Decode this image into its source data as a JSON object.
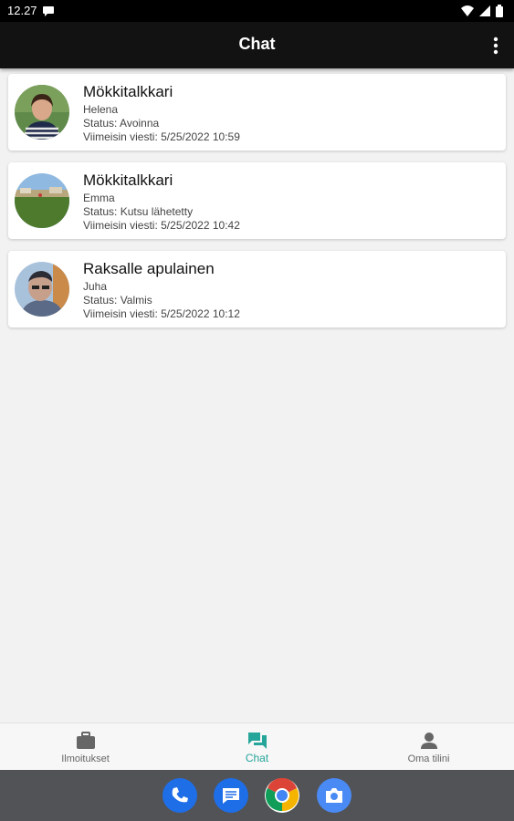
{
  "status_bar": {
    "time": "12.27"
  },
  "app_bar": {
    "title": "Chat"
  },
  "chats": [
    {
      "title": "Mökkitalkkari",
      "name": "Helena",
      "status": "Status: Avoinna",
      "last_message": "Viimeisin viesti: 5/25/2022 10:59"
    },
    {
      "title": "Mökkitalkkari",
      "name": "Emma",
      "status": "Status: Kutsu lähetetty",
      "last_message": "Viimeisin viesti: 5/25/2022 10:42"
    },
    {
      "title": "Raksalle apulainen",
      "name": "Juha",
      "status": "Status: Valmis",
      "last_message": "Viimeisin viesti: 5/25/2022 10:12"
    }
  ],
  "bottom_nav": {
    "items": [
      {
        "label": "Ilmoitukset",
        "icon": "briefcase-icon"
      },
      {
        "label": "Chat",
        "icon": "chat-icon"
      },
      {
        "label": "Oma tilini",
        "icon": "person-icon"
      }
    ],
    "active_index": 1
  },
  "dock": {
    "apps": [
      "phone-icon",
      "messages-icon",
      "chrome-icon",
      "camera-icon"
    ]
  },
  "colors": {
    "accent": "#26a69a",
    "app_bar": "#121212",
    "background": "#f2f2f2",
    "nav_bar": "#525356"
  }
}
